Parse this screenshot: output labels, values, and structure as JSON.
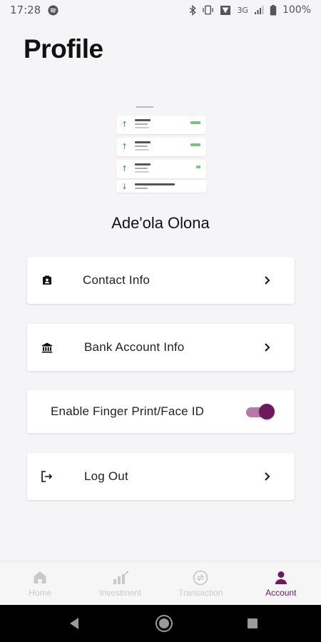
{
  "status_bar": {
    "time": "17:28",
    "network": "3G",
    "battery": "100%"
  },
  "page": {
    "title": "Profile"
  },
  "user": {
    "name": "Ade'ola Olona"
  },
  "menu": {
    "contact_label": "Contact Info",
    "bank_label": "Bank Account Info",
    "biometric_label": "Enable Finger Print/Face ID",
    "biometric_enabled": true,
    "logout_label": "Log Out"
  },
  "bottom_nav": {
    "items": [
      {
        "label": "Home",
        "icon": "home-icon",
        "active": false
      },
      {
        "label": "Investment",
        "icon": "investment-icon",
        "active": false
      },
      {
        "label": "Transaction",
        "icon": "transaction-icon",
        "active": false
      },
      {
        "label": "Account",
        "icon": "account-icon",
        "active": true
      }
    ]
  },
  "colors": {
    "accent": "#6d1a5c",
    "toggle_track": "#b57aa8",
    "background": "#f5f5f7"
  }
}
